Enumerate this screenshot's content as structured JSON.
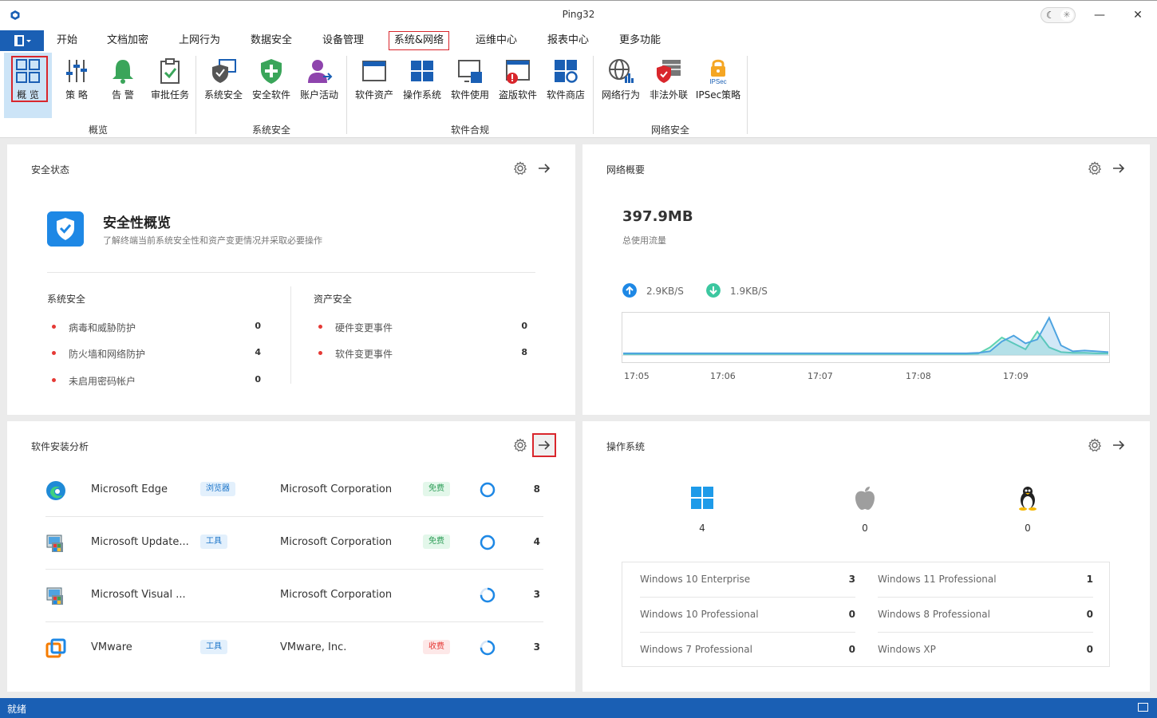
{
  "window": {
    "title": "Ping32"
  },
  "menu": {
    "tabs": [
      {
        "label": "开始"
      },
      {
        "label": "文档加密"
      },
      {
        "label": "上网行为"
      },
      {
        "label": "数据安全"
      },
      {
        "label": "设备管理"
      },
      {
        "label": "系统&网络"
      },
      {
        "label": "运维中心"
      },
      {
        "label": "报表中心"
      },
      {
        "label": "更多功能"
      }
    ],
    "active_tab": "系统&网络"
  },
  "ribbon": {
    "groups": [
      {
        "label": "概览",
        "items": [
          {
            "label": "概 览",
            "icon": "overview-grid-icon"
          },
          {
            "label": "策 略",
            "icon": "policy-sliders-icon"
          },
          {
            "label": "告 警",
            "icon": "alarm-bell-icon"
          },
          {
            "label": "审批任务",
            "icon": "approval-clipboard-icon"
          }
        ]
      },
      {
        "label": "系统安全",
        "items": [
          {
            "label": "系统安全",
            "icon": "system-shield-icon"
          },
          {
            "label": "安全软件",
            "icon": "security-software-icon"
          },
          {
            "label": "账户活动",
            "icon": "account-activity-icon"
          }
        ]
      },
      {
        "label": "软件合规",
        "items": [
          {
            "label": "软件资产",
            "icon": "software-assets-icon"
          },
          {
            "label": "操作系统",
            "icon": "operating-system-icon"
          },
          {
            "label": "软件使用",
            "icon": "software-usage-icon"
          },
          {
            "label": "盗版软件",
            "icon": "pirated-software-icon"
          },
          {
            "label": "软件商店",
            "icon": "software-store-icon"
          }
        ]
      },
      {
        "label": "网络安全",
        "items": [
          {
            "label": "网络行为",
            "icon": "network-behavior-icon"
          },
          {
            "label": "非法外联",
            "icon": "illegal-outreach-icon"
          },
          {
            "label": "IPSec策略",
            "icon": "ipsec-lock-icon",
            "badge": "IPSec"
          }
        ]
      }
    ]
  },
  "security": {
    "title": "安全状态",
    "heading": "安全性概览",
    "desc": "了解终端当前系统安全性和资产变更情况并采取必要操作",
    "system": {
      "title": "系统安全",
      "items": [
        {
          "name": "病毒和威胁防护",
          "value": "0"
        },
        {
          "name": "防火墙和网络防护",
          "value": "4"
        },
        {
          "name": "未启用密码帐户",
          "value": "0"
        }
      ]
    },
    "asset": {
      "title": "资产安全",
      "items": [
        {
          "name": "硬件变更事件",
          "value": "0"
        },
        {
          "name": "软件变更事件",
          "value": "8"
        }
      ]
    }
  },
  "network": {
    "title": "网络概要",
    "total": "397.9MB",
    "total_label": "总使用流量",
    "up": "2.9KB/S",
    "down": "1.9KB/S",
    "chart_data": {
      "type": "area",
      "x": [
        "17:05",
        "17:06",
        "17:07",
        "17:08",
        "17:09"
      ],
      "series": [
        {
          "color": "#4da3e0",
          "values": [
            0.05,
            0.05,
            0.05,
            0.05,
            0.05,
            0.05,
            0.05,
            0.05,
            0.05,
            0.05,
            0.05,
            0.05,
            0.05,
            0.05,
            0.05,
            0.05,
            0.05,
            0.05,
            0.05,
            0.05,
            0.05,
            0.05,
            0.05,
            0.05,
            0.05,
            0.05,
            0.05,
            0.05,
            0.05,
            0.05,
            0.06,
            0.1,
            0.35,
            0.5,
            0.3,
            0.4,
            0.95,
            0.25,
            0.1,
            0.12,
            0.1,
            0.08
          ]
        },
        {
          "color": "#5fd3b0",
          "values": [
            0.03,
            0.03,
            0.03,
            0.03,
            0.03,
            0.03,
            0.03,
            0.03,
            0.03,
            0.03,
            0.03,
            0.03,
            0.03,
            0.03,
            0.03,
            0.03,
            0.03,
            0.03,
            0.03,
            0.03,
            0.03,
            0.03,
            0.03,
            0.03,
            0.03,
            0.03,
            0.03,
            0.03,
            0.03,
            0.03,
            0.04,
            0.2,
            0.45,
            0.3,
            0.15,
            0.6,
            0.2,
            0.08,
            0.06,
            0.06,
            0.05,
            0.05
          ]
        }
      ],
      "ylim": [
        0,
        1
      ]
    }
  },
  "software": {
    "title": "软件安装分析",
    "rows": [
      {
        "name": "Microsoft Edge",
        "tag": "浏览器",
        "vendor": "Microsoft Corporation",
        "price": "免费",
        "ring": 1.0,
        "count": "8",
        "icon": "edge-icon"
      },
      {
        "name": "Microsoft Update...",
        "tag": "工具",
        "vendor": "Microsoft Corporation",
        "price": "免费",
        "ring": 1.0,
        "count": "4",
        "icon": "installer-icon"
      },
      {
        "name": "Microsoft Visual ...",
        "tag": "",
        "vendor": "Microsoft Corporation",
        "price": "",
        "ring": 0.75,
        "count": "3",
        "icon": "installer-icon"
      },
      {
        "name": "VMware",
        "tag": "工具",
        "vendor": "VMware, Inc.",
        "price": "收费",
        "ring": 0.75,
        "count": "3",
        "icon": "vmware-icon"
      }
    ]
  },
  "os": {
    "title": "操作系统",
    "cols": [
      {
        "icon": "windows-icon",
        "count": "4"
      },
      {
        "icon": "apple-icon",
        "count": "0"
      },
      {
        "icon": "linux-icon",
        "count": "0"
      }
    ],
    "table": [
      {
        "name": "Windows 10 Enterprise",
        "value": "3"
      },
      {
        "name": "Windows 11 Professional",
        "value": "1"
      },
      {
        "name": "Windows 10 Professional",
        "value": "0"
      },
      {
        "name": "Windows 8 Professional",
        "value": "0"
      },
      {
        "name": "Windows 7 Professional",
        "value": "0"
      },
      {
        "name": "Windows XP",
        "value": "0"
      }
    ]
  },
  "status": {
    "text": "就绪"
  },
  "colors": {
    "accent": "#1a5fb4",
    "highlight": "#d9262c",
    "selected": "#cce4f7"
  }
}
